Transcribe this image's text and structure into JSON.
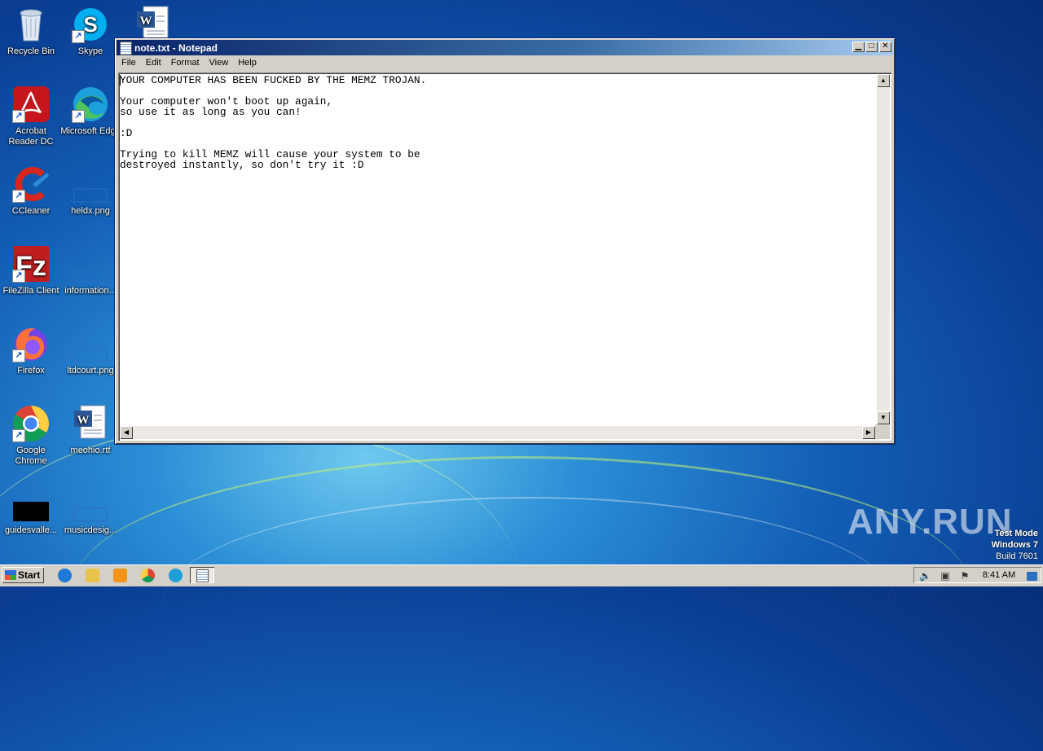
{
  "desktop": {
    "icons": [
      {
        "label": "Recycle Bin"
      },
      {
        "label": "Skype"
      },
      {
        "label": "Acrobat Reader DC"
      },
      {
        "label": "Microsoft Edge"
      },
      {
        "label": "CCleaner"
      },
      {
        "label": "heldx.png"
      },
      {
        "label": "FileZilla Client"
      },
      {
        "label": "information..."
      },
      {
        "label": "Firefox"
      },
      {
        "label": "ltdcourt.png"
      },
      {
        "label": "Google Chrome"
      },
      {
        "label": "meohio.rtf"
      },
      {
        "label": "guidesvalle..."
      },
      {
        "label": "musicdesig..."
      }
    ]
  },
  "notepad": {
    "title": "note.txt - Notepad",
    "menu": [
      "File",
      "Edit",
      "Format",
      "View",
      "Help"
    ],
    "content": "YOUR COMPUTER HAS BEEN FUCKED BY THE MEMZ TROJAN.\n\nYour computer won't boot up again,\nso use it as long as you can!\n\n:D\n\nTrying to kill MEMZ will cause your system to be\ndestroyed instantly, so don't try it :D"
  },
  "watermark": {
    "brand": "ANY.RUN",
    "test_mode": "Test Mode",
    "os": "Windows 7",
    "build": "Build 7601"
  },
  "taskbar": {
    "start_label": "Start",
    "clock": "8:41 AM"
  }
}
